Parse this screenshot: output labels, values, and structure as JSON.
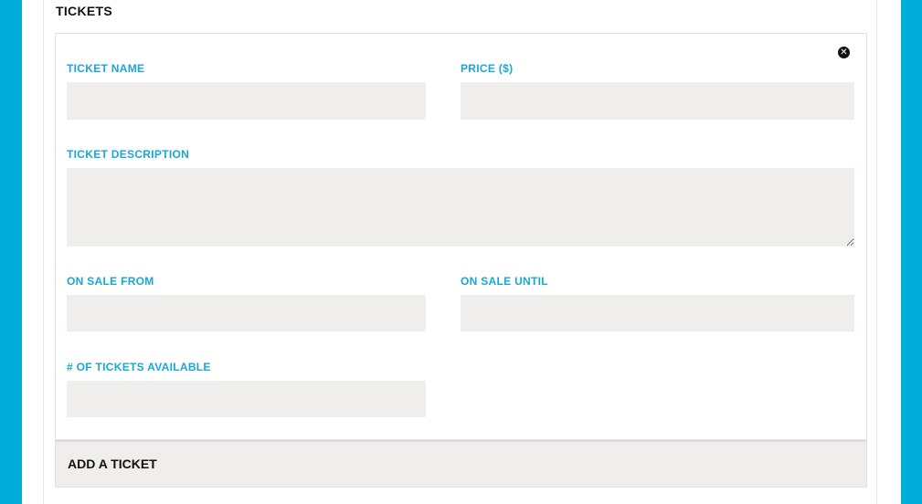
{
  "section": {
    "title": "TICKETS"
  },
  "ticket": {
    "close_icon": "close-circle-icon",
    "fields": {
      "name": {
        "label": "TICKET NAME",
        "value": ""
      },
      "price": {
        "label": "PRICE ($)",
        "value": ""
      },
      "description": {
        "label": "TICKET DESCRIPTION",
        "value": ""
      },
      "on_sale_from": {
        "label": "ON SALE FROM",
        "value": ""
      },
      "on_sale_until": {
        "label": "ON SALE UNTIL",
        "value": ""
      },
      "quantity": {
        "label": "# OF TICKETS AVAILABLE",
        "value": ""
      }
    }
  },
  "actions": {
    "add_ticket": "ADD A TICKET"
  },
  "colors": {
    "frame": "#00acd8",
    "label": "#1aa7d6",
    "field_bg": "#efeeec"
  }
}
